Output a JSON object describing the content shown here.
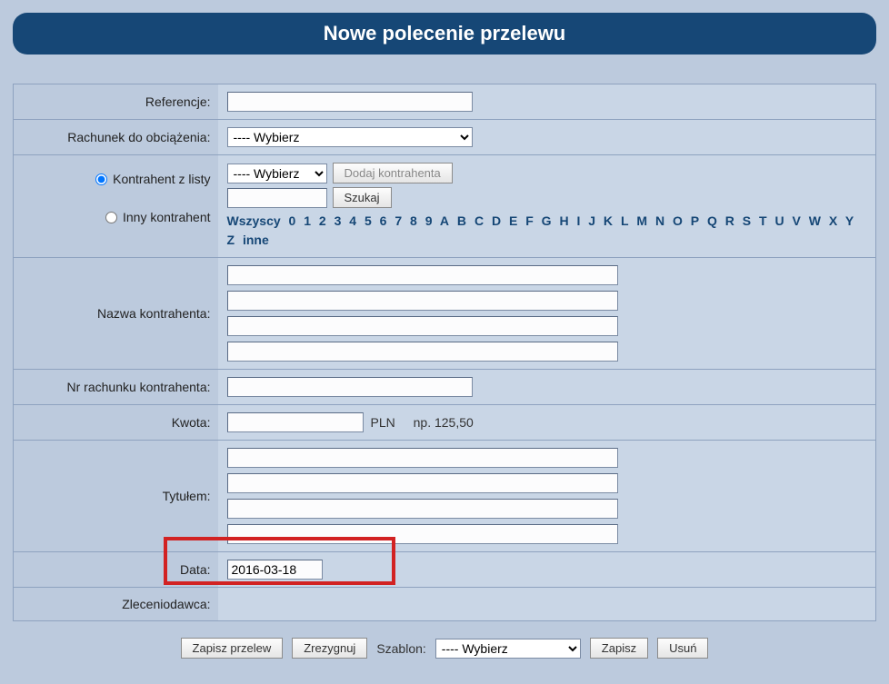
{
  "title": "Nowe polecenie przelewu",
  "labels": {
    "referencje": "Referencje:",
    "rachunek": "Rachunek do obciążenia:",
    "kontrahent_lista": "Kontrahent z listy",
    "inny_kontrahent": "Inny kontrahent",
    "nazwa_kontrahenta": "Nazwa kontrahenta:",
    "nr_rachunku": "Nr rachunku kontrahenta:",
    "kwota": "Kwota:",
    "tytulem": "Tytułem:",
    "data": "Data:",
    "zleceniodawca": "Zleceniodawca:"
  },
  "select_placeholder": "---- Wybierz",
  "buttons": {
    "dodaj_kontrahenta": "Dodaj kontrahenta",
    "szukaj": "Szukaj",
    "zapisz_przelew": "Zapisz przelew",
    "zrezygnuj": "Zrezygnuj",
    "zapisz": "Zapisz",
    "usun": "Usuń"
  },
  "alpha_links": [
    "Wszyscy",
    "0",
    "1",
    "2",
    "3",
    "4",
    "5",
    "6",
    "7",
    "8",
    "9",
    "A",
    "B",
    "C",
    "D",
    "E",
    "F",
    "G",
    "H",
    "I",
    "J",
    "K",
    "L",
    "M",
    "N",
    "O",
    "P",
    "Q",
    "R",
    "S",
    "T",
    "U",
    "V",
    "W",
    "X",
    "Y",
    "Z",
    "inne"
  ],
  "kwota_currency": "PLN",
  "kwota_hint": "np. 125,50",
  "data_value": "2016-03-18",
  "footer_label": "Szablon:",
  "values": {
    "referencje": "",
    "rachunek": "---- Wybierz",
    "kontrahent_select": "---- Wybierz",
    "search": "",
    "nazwa1": "",
    "nazwa2": "",
    "nazwa3": "",
    "nazwa4": "",
    "nr_rachunku": "",
    "kwota": "",
    "tyt1": "",
    "tyt2": "",
    "tyt3": "",
    "tyt4": "",
    "szablon": "---- Wybierz"
  }
}
